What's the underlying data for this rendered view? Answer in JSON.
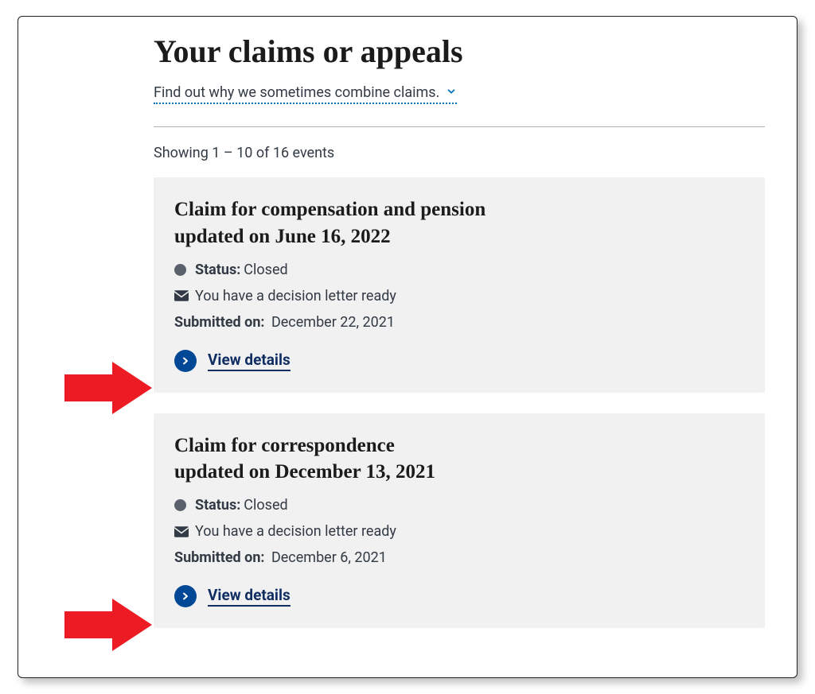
{
  "page": {
    "title": "Your claims or appeals",
    "expand_link": "Find out why we sometimes combine claims.",
    "showing_text": "Showing 1 – 10 of 16 events"
  },
  "labels": {
    "status": "Status:",
    "submitted_on": "Submitted on:",
    "view_details": "View details"
  },
  "cards": [
    {
      "title_line1": "Claim for compensation and pension",
      "title_line2": "updated on June 16, 2022",
      "status_value": "Closed",
      "letter_msg": "You have a decision letter ready",
      "submitted_value": "December 22, 2021"
    },
    {
      "title_line1": "Claim for correspondence",
      "title_line2": "updated on December 13, 2021",
      "status_value": "Closed",
      "letter_msg": "You have a decision letter ready",
      "submitted_value": "December 6, 2021"
    }
  ]
}
